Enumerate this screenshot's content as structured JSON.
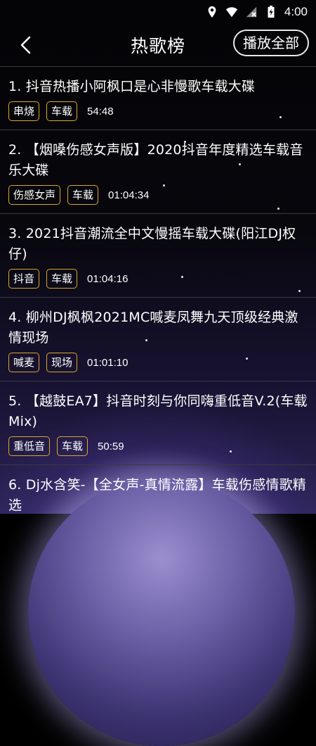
{
  "status_bar": {
    "time": "4:00",
    "icons": [
      "location-icon",
      "wifi-icon",
      "no-sim-icon",
      "battery-icon"
    ]
  },
  "header": {
    "back_icon": "chevron-left-icon",
    "title": "热歌榜",
    "play_all_label": "播放全部"
  },
  "theme": {
    "tag_border": "#d9a72b",
    "divider": "#3a3a40"
  },
  "songs": [
    {
      "title": "1. 抖音热播小阿枫口是心非慢歌车载大碟",
      "tags": [
        "串烧",
        "车载"
      ],
      "duration": "54:48"
    },
    {
      "title": "2. 【烟嗓伤感女声版】2020抖音年度精选车载音乐大碟",
      "tags": [
        "伤感女声",
        "车载"
      ],
      "duration": "01:04:34"
    },
    {
      "title": "3. 2021抖音潮流全中文慢摇车载大碟(阳江DJ权仔)",
      "tags": [
        "抖音",
        "车载"
      ],
      "duration": "01:04:16"
    },
    {
      "title": "4. 柳州DJ枫枫2021MC喊麦凤舞九天顶级经典激情现场",
      "tags": [
        "喊麦",
        "现场"
      ],
      "duration": "01:01:10"
    },
    {
      "title": "5. 【越鼓EA7】抖音时刻与你同嗨重低音V.2(车载Mix)",
      "tags": [
        "重低音",
        "车载"
      ],
      "duration": "50:59"
    },
    {
      "title": "6. Dj水含笑-【全女声-真情流露】车载伤感情歌精选",
      "tags": [],
      "duration": ""
    }
  ]
}
